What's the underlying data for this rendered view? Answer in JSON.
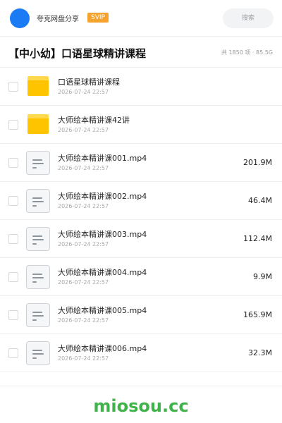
{
  "header": {
    "app_name": "夸克网盘分享",
    "badge": "SVIP",
    "search_placeholder": "搜索"
  },
  "share": {
    "title": "【中小幼】口语星球精讲课程",
    "summary": "共 1850 项 · 85.5G"
  },
  "files": [
    {
      "name": "口语星球精讲课程",
      "date": "2026-07-24 22:57",
      "size": "",
      "type": "folder"
    },
    {
      "name": "大师绘本精讲课42讲",
      "date": "2026-07-24 22:57",
      "size": "",
      "type": "folder"
    },
    {
      "name": "大师绘本精讲课001.mp4",
      "date": "2026-07-24 22:57",
      "size": "201.9M",
      "type": "file"
    },
    {
      "name": "大师绘本精讲课002.mp4",
      "date": "2026-07-24 22:57",
      "size": "46.4M",
      "type": "file"
    },
    {
      "name": "大师绘本精讲课003.mp4",
      "date": "2026-07-24 22:57",
      "size": "112.4M",
      "type": "file"
    },
    {
      "name": "大师绘本精讲课004.mp4",
      "date": "2026-07-24 22:57",
      "size": "9.9M",
      "type": "file"
    },
    {
      "name": "大师绘本精讲课005.mp4",
      "date": "2026-07-24 22:57",
      "size": "165.9M",
      "type": "file"
    },
    {
      "name": "大师绘本精讲课006.mp4",
      "date": "2026-07-24 22:57",
      "size": "32.3M",
      "type": "file"
    }
  ],
  "watermark": "miosou.cc",
  "colors": {
    "avatar": "#1b7bf5",
    "svip_badge": "#f3a32e",
    "folder": "#ffc400",
    "watermark": "#3fb349"
  }
}
